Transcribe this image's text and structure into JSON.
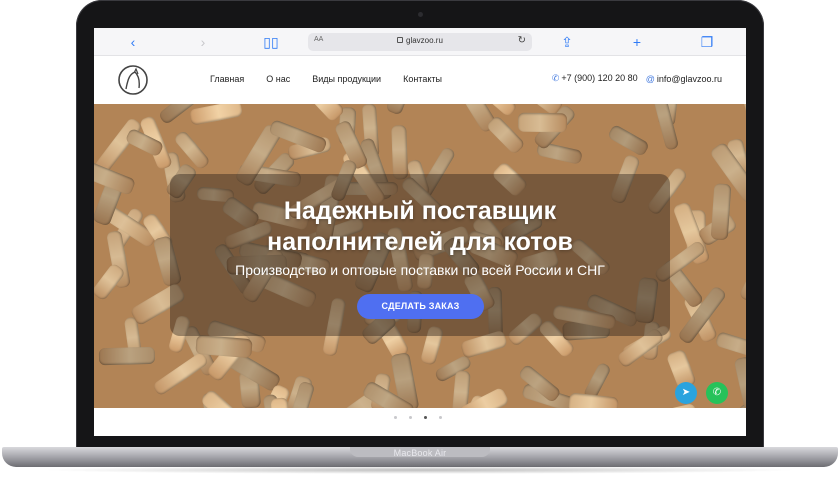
{
  "browser": {
    "url_text": "glavzoo.ru",
    "text_size_label": "AA",
    "icons": [
      "back-icon",
      "forward-icon",
      "bookmarks-icon",
      "reload-icon",
      "share-icon",
      "new-tab-icon",
      "tabs-icon"
    ]
  },
  "site": {
    "nav": [
      "Главная",
      "О нас",
      "Виды продукции",
      "Контакты"
    ],
    "phone": "+7 (900) 120 20 80",
    "email": "info@glavzoo.ru"
  },
  "hero": {
    "title_line1": "Надежный поставщик",
    "title_line2": "наполнителей для котов",
    "subtitle": "Производство и оптовые поставки по всей России и СНГ",
    "cta": "СДЕЛАТЬ ЗАКАЗ",
    "slides": 4,
    "active_slide": 3
  },
  "device": {
    "label": "MacBook Air"
  },
  "colors": {
    "accent": "#4f6ff1",
    "telegram": "#2aa3de",
    "whatsapp": "#26c25a"
  }
}
